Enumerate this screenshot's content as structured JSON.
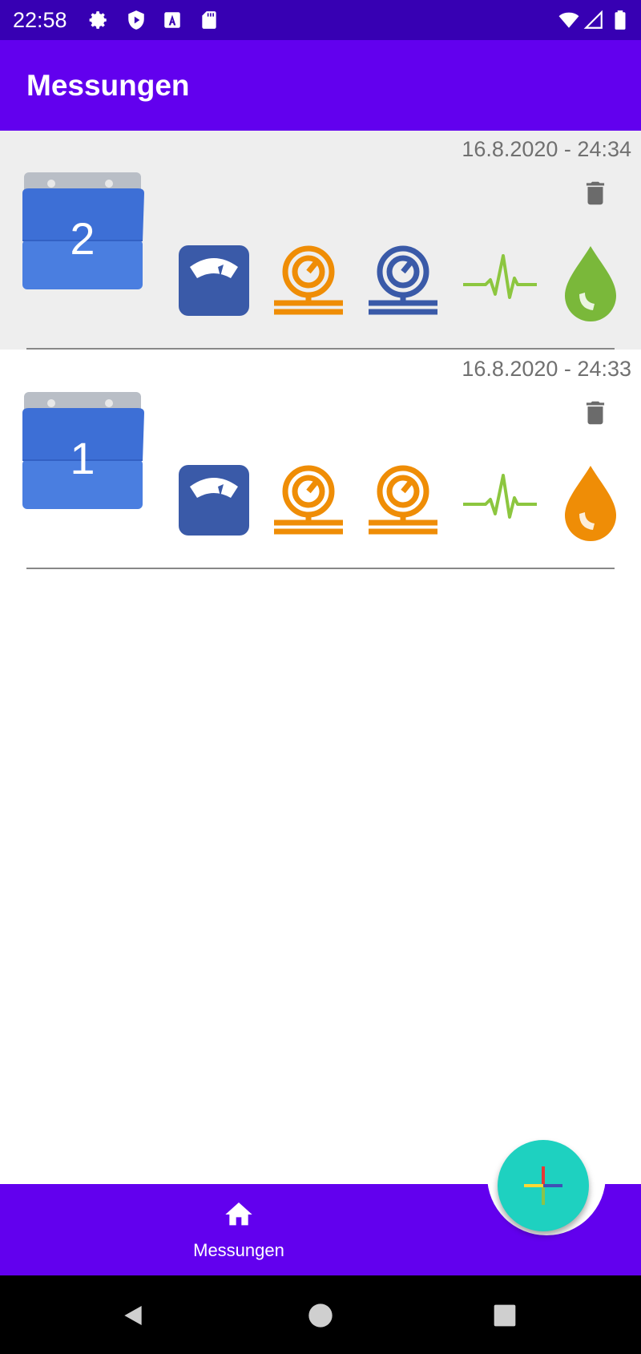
{
  "status_bar": {
    "time": "22:58",
    "left_icons": [
      "settings-icon",
      "play-protect-icon",
      "a-letter-icon",
      "sd-card-icon"
    ],
    "right_icons": [
      "wifi-icon",
      "signal-icon",
      "battery-icon"
    ]
  },
  "app_bar": {
    "title": "Messungen"
  },
  "measurements": [
    {
      "number": "2",
      "date": "16.8.2020 - 24:34",
      "selected": true,
      "indicators": [
        {
          "icon": "scale-icon",
          "color": "#3a5aa8"
        },
        {
          "icon": "pressure-gauge-icon",
          "color": "#ef8d06"
        },
        {
          "icon": "pressure-gauge-icon",
          "color": "#3a5aa8"
        },
        {
          "icon": "pulse-icon",
          "color": "#8cc63f"
        },
        {
          "icon": "drop-icon",
          "color": "#7ab83a"
        }
      ]
    },
    {
      "number": "1",
      "date": "16.8.2020 - 24:33",
      "selected": false,
      "indicators": [
        {
          "icon": "scale-icon",
          "color": "#3a5aa8"
        },
        {
          "icon": "pressure-gauge-icon",
          "color": "#ef8d06"
        },
        {
          "icon": "pressure-gauge-icon",
          "color": "#ef8d06"
        },
        {
          "icon": "pulse-icon",
          "color": "#8cc63f"
        },
        {
          "icon": "drop-icon",
          "color": "#ef8d06"
        }
      ]
    }
  ],
  "bottom_nav": {
    "home_label": "Messungen"
  },
  "fab": {
    "icon": "colorful-plus-icon"
  },
  "colors": {
    "status_bar": "#3700b3",
    "primary": "#6200ee",
    "fab": "#1ed1c0",
    "selected_row": "#eeeeee"
  }
}
